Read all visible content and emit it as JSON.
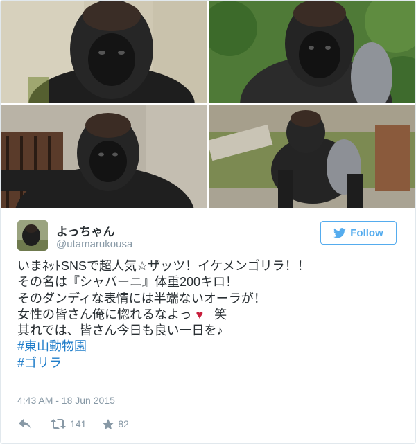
{
  "tweet": {
    "display_name": "よっちゃん",
    "handle": "@utamarukousa",
    "follow_label": "Follow",
    "text_lines": [
      "いまﾈｯﾄSNSで超人気☆ザッツ！イケメンゴリラ！！",
      "その名は『シャバーニ』体重200キロ！",
      "そのダンディな表情には半端ないオーラが！",
      "女性の皆さん俺に惚れるなよっ",
      "笑",
      "其れでは、皆さん今日も良い一日を♪"
    ],
    "heart_symbol": "♥",
    "hashtags": [
      "#東山動物園",
      "#ゴリラ"
    ],
    "timestamp": "4:43 AM - 18 Jun 2015",
    "retweet_count": "141",
    "favorite_count": "82"
  },
  "icons": {
    "follow": "twitter-bird-icon",
    "reply": "reply-icon",
    "retweet": "retweet-icon",
    "favorite": "star-icon"
  },
  "colors": {
    "twitter_blue": "#55acee",
    "link_blue": "#1e7cc9",
    "heart_red": "#c81e3c",
    "muted_gray": "#8899a6",
    "text": "#292f33"
  }
}
